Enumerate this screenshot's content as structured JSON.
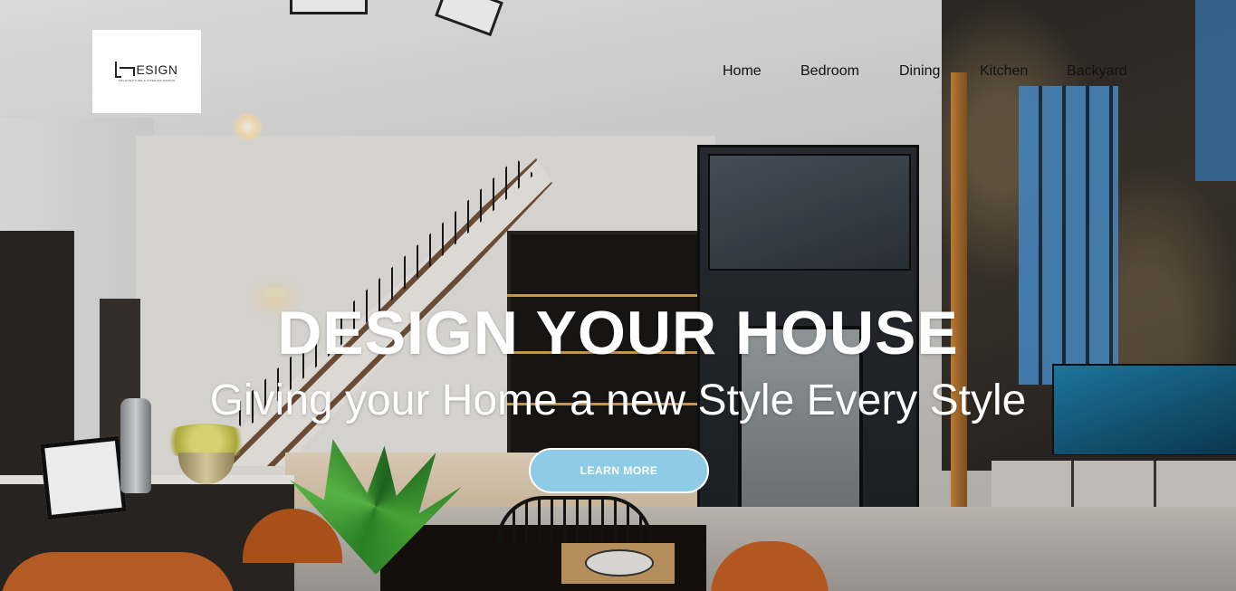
{
  "brand": {
    "logo_text": "ESIGN",
    "logo_tagline": "ARCHITECTURE & INTERIOR DESIGN"
  },
  "nav": {
    "items": [
      {
        "label": "Home"
      },
      {
        "label": "Bedroom"
      },
      {
        "label": "Dining"
      },
      {
        "label": "Kitchen"
      },
      {
        "label": "Backyard"
      }
    ]
  },
  "hero": {
    "title": "DESIGN YOUR HOUSE",
    "subtitle": "Giving your Home a new Style Every Style",
    "cta_label": "LEARN MORE"
  },
  "colors": {
    "cta_background": "#8ecbe6",
    "hero_text": "#ffffff",
    "nav_text": "#111111"
  }
}
